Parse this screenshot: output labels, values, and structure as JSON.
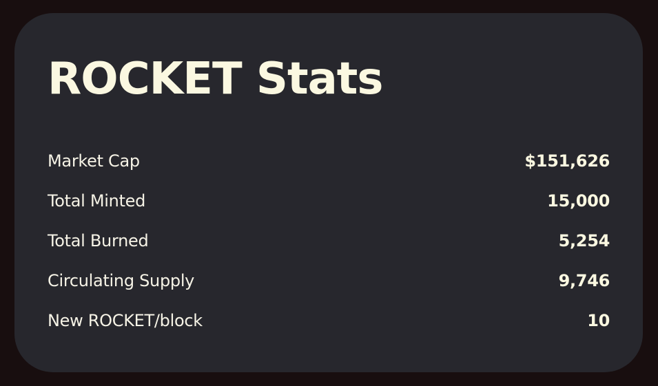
{
  "colors": {
    "page_background": "#180e0f",
    "card_background": "#27272d",
    "text": "#fbf8e1"
  },
  "card": {
    "title": "ROCKET Stats",
    "stats": [
      {
        "label": "Market Cap",
        "value": "$151,626"
      },
      {
        "label": "Total Minted",
        "value": "15,000"
      },
      {
        "label": "Total Burned",
        "value": "5,254"
      },
      {
        "label": "Circulating Supply",
        "value": "9,746"
      },
      {
        "label": "New ROCKET/block",
        "value": "10"
      }
    ]
  }
}
